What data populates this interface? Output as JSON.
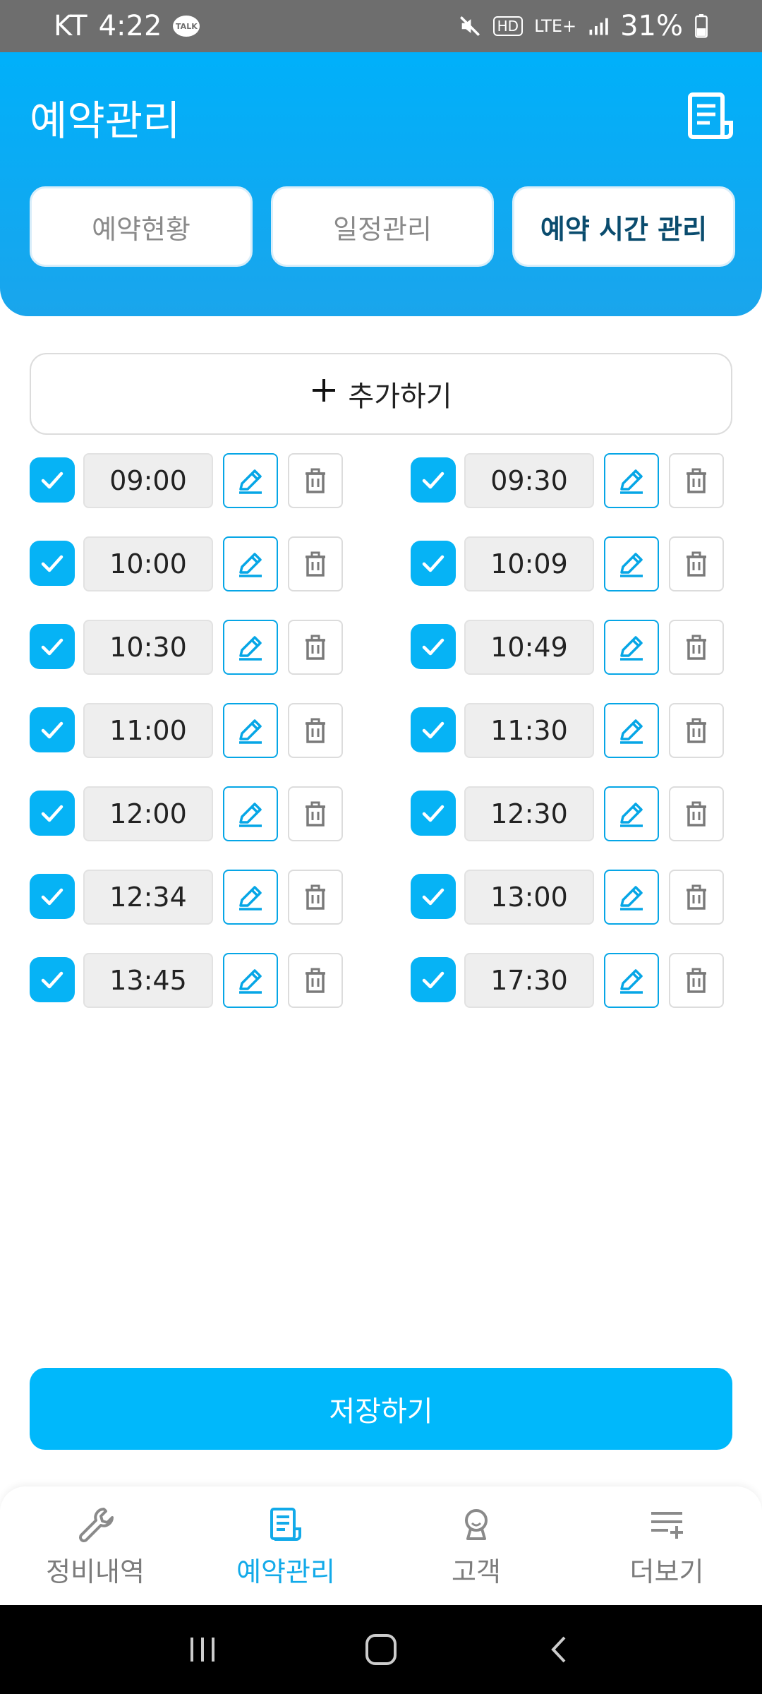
{
  "status_bar": {
    "carrier": "KT",
    "time": "4:22",
    "talk_badge": "TALK",
    "network": "LTE+",
    "hd": "HD",
    "battery": "31%"
  },
  "header": {
    "title": "예약관리",
    "tabs": [
      {
        "label": "예약현황"
      },
      {
        "label": "일정관리"
      },
      {
        "label": "예약 시간 관리"
      }
    ],
    "active_tab": "예약 시간 관리"
  },
  "add_button": {
    "label": "추가하기"
  },
  "slots": {
    "left": [
      {
        "time": "09:00",
        "checked": true
      },
      {
        "time": "10:00",
        "checked": true
      },
      {
        "time": "10:30",
        "checked": true
      },
      {
        "time": "11:00",
        "checked": true
      },
      {
        "time": "12:00",
        "checked": true
      },
      {
        "time": "12:34",
        "checked": true
      },
      {
        "time": "13:45",
        "checked": true
      }
    ],
    "right": [
      {
        "time": "09:30",
        "checked": true
      },
      {
        "time": "10:09",
        "checked": true
      },
      {
        "time": "10:49",
        "checked": true
      },
      {
        "time": "11:30",
        "checked": true
      },
      {
        "time": "12:30",
        "checked": true
      },
      {
        "time": "13:00",
        "checked": true
      },
      {
        "time": "17:30",
        "checked": true
      }
    ]
  },
  "save_button": {
    "label": "저장하기"
  },
  "bottom_nav": {
    "items": [
      {
        "label": "정비내역",
        "icon": "wrench-icon"
      },
      {
        "label": "예약관리",
        "icon": "document-icon"
      },
      {
        "label": "고객",
        "icon": "customer-icon"
      },
      {
        "label": "더보기",
        "icon": "more-list-icon"
      }
    ],
    "active": "예약관리"
  },
  "colors": {
    "accent": "#00b8fb",
    "header_gradient_top": "#00b0fa",
    "header_gradient_bottom": "#1aa5ec",
    "checkbox": "#06b3f5",
    "active_tab_text": "#0a4c6e",
    "nav_active": "#12aae9"
  }
}
